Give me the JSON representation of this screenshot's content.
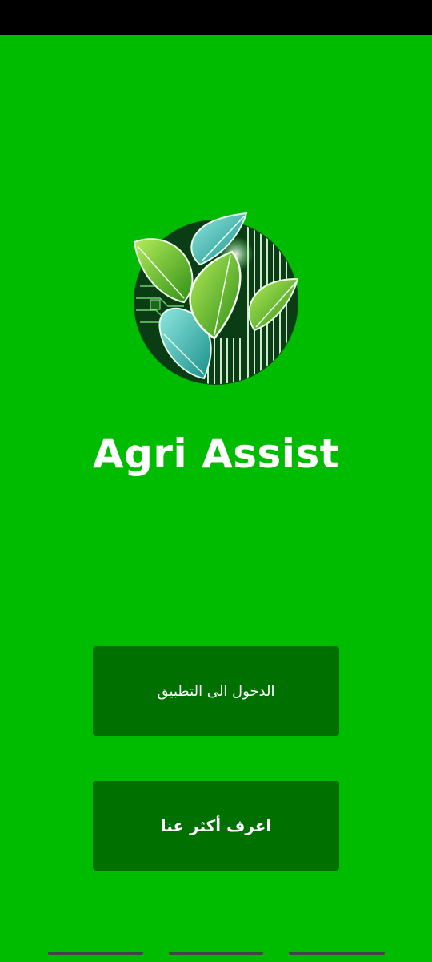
{
  "app": {
    "title": "Agri Assist",
    "logo_icon": "leaf-circuit-logo-icon"
  },
  "buttons": {
    "enter_app_label": "الدخول الى التطبيق",
    "about_us_label": "اعرف أكثر عنا"
  },
  "colors": {
    "background": "#00bc00",
    "button": "#007000",
    "text": "#ffffff"
  }
}
